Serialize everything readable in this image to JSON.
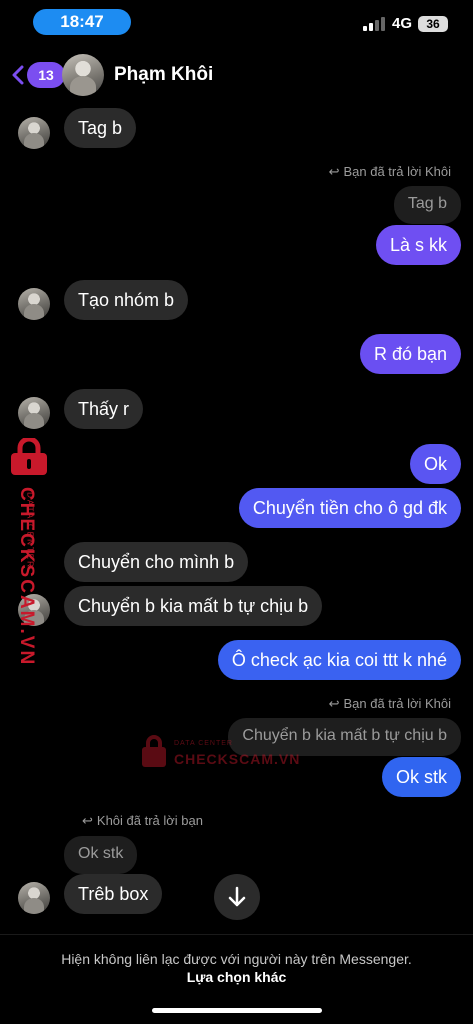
{
  "status": {
    "time": "18:47",
    "network": "4G",
    "battery": "36"
  },
  "header": {
    "back_count": "13",
    "contact_name": "Phạm Khôi"
  },
  "messages": [
    {
      "text": "Tag b"
    },
    {
      "reply_note": "Bạn đã trả lời Khôi",
      "quote": "Tag b",
      "text": "Là s kk"
    },
    {
      "text": "Tạo nhóm b"
    },
    {
      "text": "R đó bạn"
    },
    {
      "text": "Thấy r"
    },
    {
      "text": "Ok"
    },
    {
      "text": "Chuyển tiền cho ô gd đk"
    },
    {
      "text": "Chuyển cho mình b"
    },
    {
      "text": "Chuyển b kia mất b tự chịu b"
    },
    {
      "text": "Ô check ạc kia coi ttt k nhé"
    },
    {
      "reply_note": "Bạn đã trả lời Khôi",
      "quote": "Chuyển b kia mất b tự chịu b",
      "text": "Ok stk"
    },
    {
      "reply_note": "Khôi đã trả lời bạn",
      "quote": "Ok stk",
      "text": "Trêb box"
    }
  ],
  "watermark": {
    "brand": "CHECKSCAM.VN",
    "tagline": "DATA CENTER",
    "color": "#c8192b"
  },
  "footer": {
    "note": "Hiện không liên lạc được với người này trên Messenger.",
    "option": "Lựa chọn khác"
  },
  "colors": {
    "accent": "#7b4ef0",
    "bubble_in": "#2b2b2b",
    "bubble_out_top": "#6a4ff2",
    "bubble_out_bottom": "#2f66f0"
  }
}
